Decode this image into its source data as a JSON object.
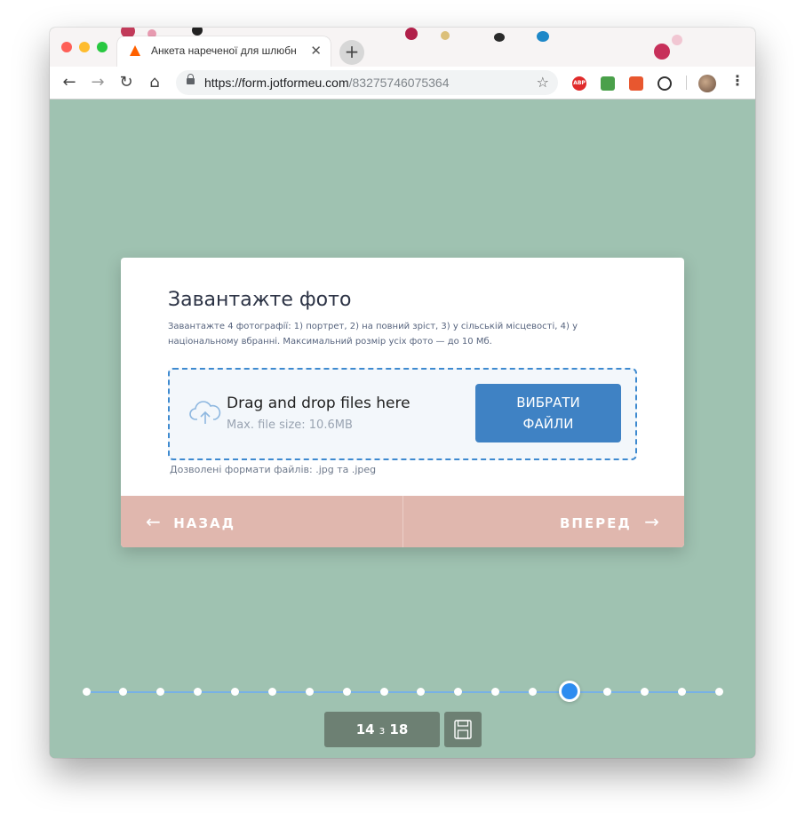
{
  "browser": {
    "tab": {
      "title": "Анкета нареченої для шлюбн",
      "favicon": "jotform-icon"
    },
    "url": {
      "host": "https://form.jotformeu.com",
      "path": "/83275746075364"
    },
    "extensions": [
      "abp-icon",
      "evernote-icon",
      "translate-icon",
      "copy-icon"
    ],
    "abp_label": "ABP"
  },
  "form": {
    "title": "Завантажте фото",
    "description": "Завантажте 4 фотографії: 1) портрет, 2) на повний зріст, 3) у сільській місцевості, 4) у національному вбранні. Максимальний розмір усіх фото — до 10 Мб.",
    "dropzone": {
      "main_text": "Drag and drop files here",
      "sub_text": "Max. file size: 10.6MB",
      "button_label": "ВИБРАТИ\nФАЙЛИ"
    },
    "allowed_formats": "Дозволені формати файлів: .jpg та .jpeg",
    "footer": {
      "back_label": "НАЗАД",
      "next_label": "ВПЕРЕД"
    }
  },
  "progress": {
    "current": "14",
    "separator": "з",
    "total": "18",
    "current_index": 14,
    "total_count": 18
  },
  "colors": {
    "page_background": "#9fc2b1",
    "accent_blue": "#3f82c4",
    "footer_pink": "#e0b7ae",
    "counter_bg": "#6d8073"
  }
}
